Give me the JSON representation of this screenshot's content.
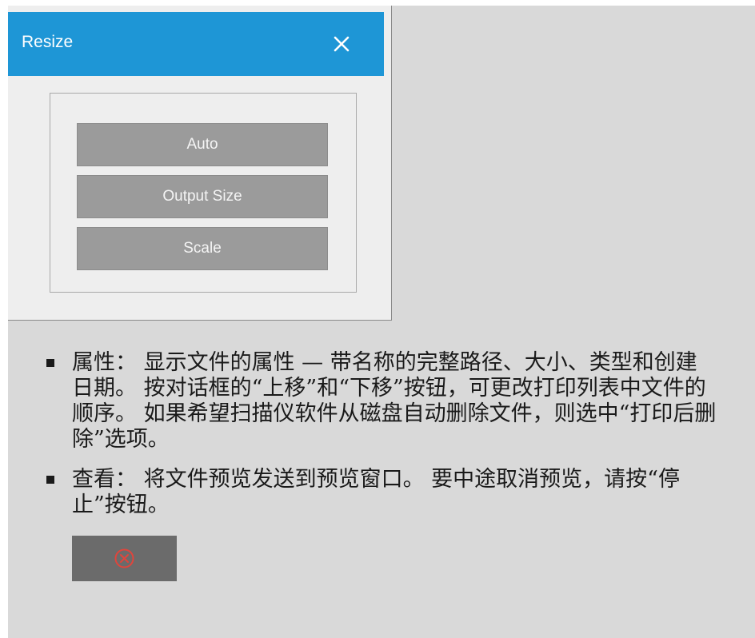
{
  "dialog": {
    "title": "Resize",
    "close_icon": "close-icon",
    "buttons": [
      {
        "label": "Auto"
      },
      {
        "label": "Output Size"
      },
      {
        "label": "Scale"
      }
    ]
  },
  "content": {
    "items": [
      {
        "text": "属性： 显示文件的属性 — 带名称的完整路径、大小、类型和创建日期。 按对话框的“上移”和“下移”按钮，可更改打印列表中文件的顺序。 如果希望扫描仪软件从磁盘自动删除文件，则选中“打印后删除”选项。"
      },
      {
        "text": "查看： 将文件预览发送到预览窗口。 要中途取消预览，请按“停止”按钮。"
      }
    ],
    "stop_icon": "stop-icon"
  },
  "colors": {
    "titlebar": "#1e96d6",
    "canvas": "#d9d9d9",
    "dialog_bg": "#eeeeee",
    "button_bg": "#9b9b9b",
    "stop_bg": "#6b6b6b",
    "stop_icon": "#e0453c"
  }
}
